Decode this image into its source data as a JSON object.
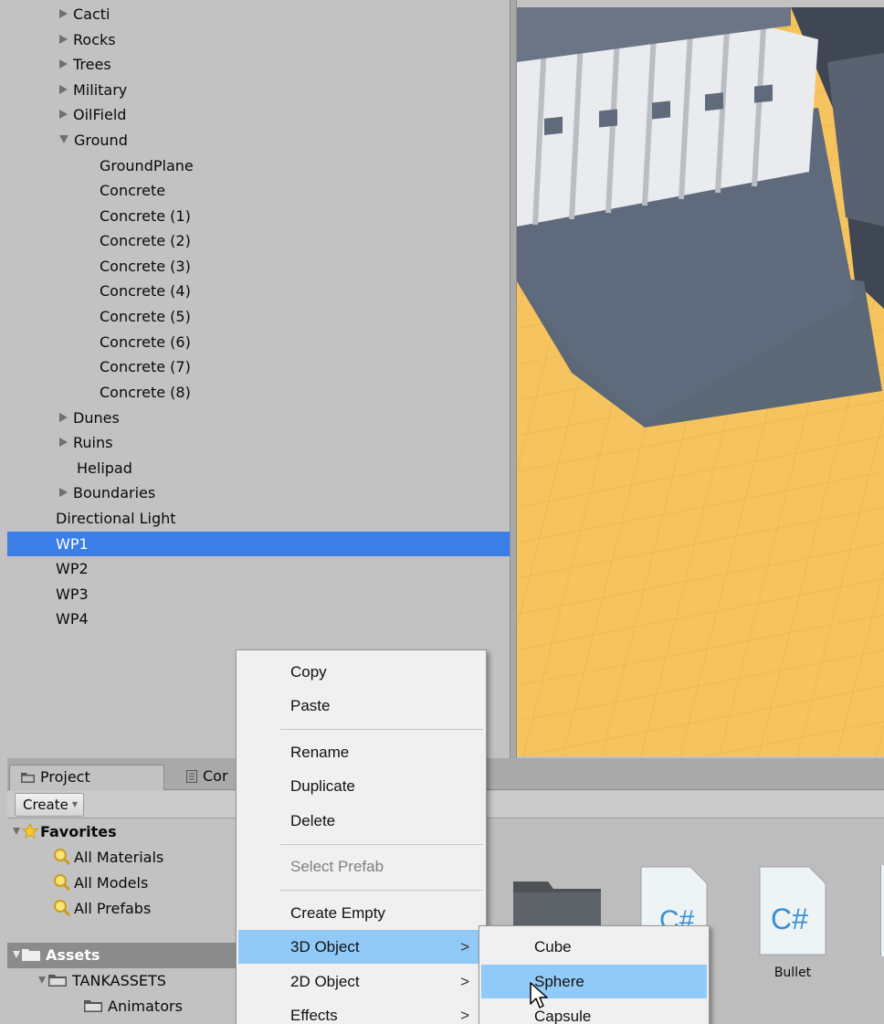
{
  "hierarchy": {
    "items": [
      {
        "label": "Cacti",
        "expander": "right"
      },
      {
        "label": "Rocks",
        "expander": "right"
      },
      {
        "label": "Trees",
        "expander": "right"
      },
      {
        "label": "Military",
        "expander": "right"
      },
      {
        "label": "OilField",
        "expander": "right"
      },
      {
        "label": "Ground",
        "expander": "down"
      },
      {
        "label": "GroundPlane"
      },
      {
        "label": "Concrete"
      },
      {
        "label": "Concrete (1)"
      },
      {
        "label": "Concrete (2)"
      },
      {
        "label": "Concrete (3)"
      },
      {
        "label": "Concrete (4)"
      },
      {
        "label": "Concrete (5)"
      },
      {
        "label": "Concrete (6)"
      },
      {
        "label": "Concrete (7)"
      },
      {
        "label": "Concrete (8)"
      },
      {
        "label": "Dunes",
        "expander": "right"
      },
      {
        "label": "Ruins",
        "expander": "right"
      },
      {
        "label": "Helipad"
      },
      {
        "label": "Boundaries",
        "expander": "right"
      },
      {
        "label": "Directional Light"
      },
      {
        "label": "WP1",
        "selected": true
      },
      {
        "label": "WP2"
      },
      {
        "label": "WP3"
      },
      {
        "label": "WP4"
      }
    ]
  },
  "project": {
    "tabs": {
      "project": "Project",
      "console": "Cor"
    },
    "create_label": "Create",
    "favorites": {
      "title": "Favorites",
      "items": [
        "All Materials",
        "All Models",
        "All Prefabs"
      ]
    },
    "assets": {
      "title": "Assets",
      "tankassets": "TANKASSETS",
      "animators": "Animators"
    },
    "grid": {
      "bullet_label": "Bullet",
      "script_glyph": "C#"
    }
  },
  "context_menu": {
    "copy": "Copy",
    "paste": "Paste",
    "rename": "Rename",
    "duplicate": "Duplicate",
    "delete": "Delete",
    "select_prefab": "Select Prefab",
    "create_empty": "Create Empty",
    "object_3d": "3D Object",
    "object_2d": "2D Object",
    "effects": "Effects",
    "arrow": ">"
  },
  "submenu": {
    "items": [
      "Cube",
      "Sphere",
      "Capsule"
    ]
  },
  "colors": {
    "selection": "#3b7ee8",
    "menu_highlight": "#91c9f7",
    "ground": "#f5c45e"
  }
}
